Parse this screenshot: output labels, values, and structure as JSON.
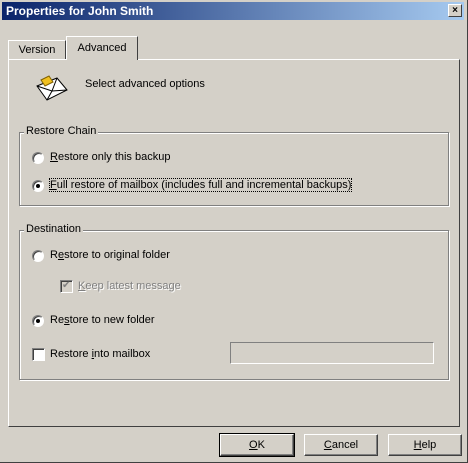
{
  "window": {
    "title": "Properties for John Smith",
    "close_glyph": "×"
  },
  "tabs": [
    {
      "label": "Version",
      "selected": false
    },
    {
      "label": "Advanced",
      "selected": true
    }
  ],
  "header": {
    "icon": "envelope-icon",
    "text": "Select advanced options"
  },
  "restore_chain": {
    "label": "Restore Chain",
    "options": [
      {
        "label_u": "R",
        "label_rest": "estore only this backup",
        "checked": false
      },
      {
        "label_u": "F",
        "label_rest": "ull restore of mailbox (includes full and incremental backups)",
        "checked": true
      }
    ]
  },
  "destination": {
    "label": "Destination",
    "original": {
      "label_pre": "R",
      "label_u": "e",
      "label_rest": "store to original folder",
      "checked": false
    },
    "keep_latest": {
      "label_u": "K",
      "label_rest": "eep latest message",
      "checked": true,
      "disabled": true
    },
    "new_folder": {
      "label_pre": "Re",
      "label_u": "s",
      "label_rest": "tore to new folder",
      "checked": true
    },
    "into_mailbox": {
      "label_pre": "Restore ",
      "label_u": "i",
      "label_rest": "nto mailbox",
      "checked": false,
      "value": ""
    }
  },
  "buttons": {
    "ok_u": "O",
    "ok_rest": "K",
    "cancel_u": "C",
    "cancel_rest": "ancel",
    "help_u": "H",
    "help_rest": "elp"
  },
  "colors": {
    "face": "#d4d0c8",
    "title_start": "#0a246a",
    "title_end": "#a6caf0"
  }
}
